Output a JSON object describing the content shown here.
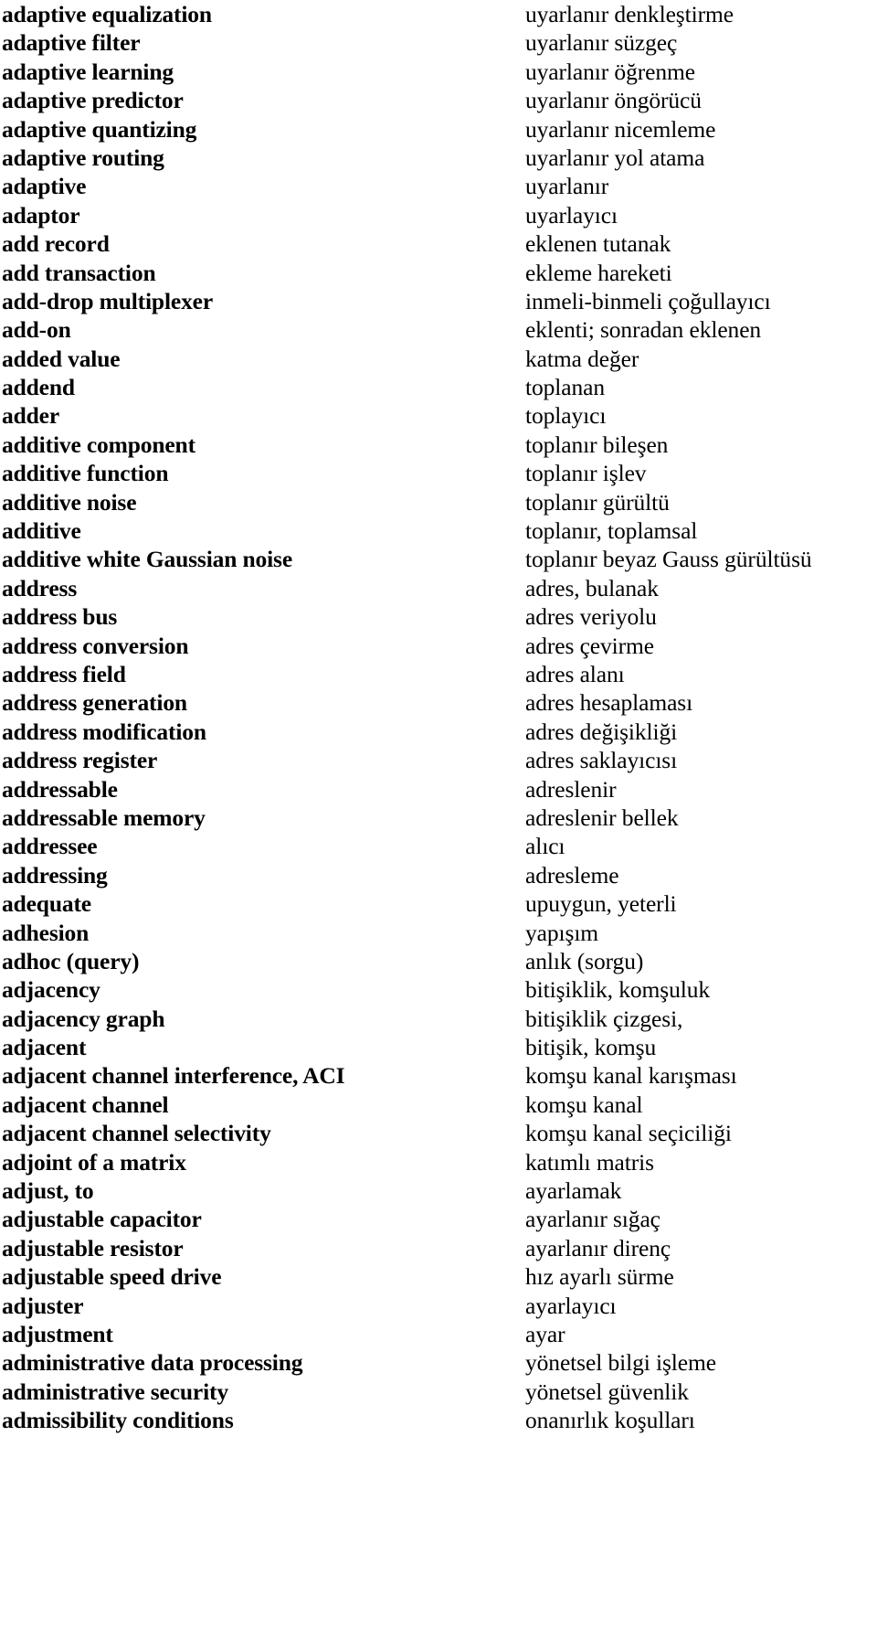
{
  "document": {
    "type": "bilingual-glossary",
    "source_language": "English",
    "target_language": "Turkish",
    "column_headers_visible": false,
    "entry_count": 56
  },
  "entries": [
    {
      "term": "adaptive equalization",
      "gloss": "uyarlanır denkleştirme"
    },
    {
      "term": "adaptive filter",
      "gloss": "uyarlanır süzgeç"
    },
    {
      "term": "adaptive learning",
      "gloss": "uyarlanır öğrenme"
    },
    {
      "term": "adaptive predictor",
      "gloss": "uyarlanır öngörücü"
    },
    {
      "term": "adaptive quantizing",
      "gloss": "uyarlanır nicemleme"
    },
    {
      "term": "adaptive routing",
      "gloss": "uyarlanır yol atama"
    },
    {
      "term": "adaptive",
      "gloss": "uyarlanır"
    },
    {
      "term": "adaptor",
      "gloss": "uyarlayıcı"
    },
    {
      "term": "add record",
      "gloss": "eklenen tutanak"
    },
    {
      "term": "add transaction",
      "gloss": "ekleme hareketi"
    },
    {
      "term": "add-drop multiplexer",
      "gloss": "inmeli-binmeli çoğullayıcı"
    },
    {
      "term": "add-on",
      "gloss": "eklenti; sonradan eklenen"
    },
    {
      "term": "added value",
      "gloss": "katma değer"
    },
    {
      "term": "addend",
      "gloss": "toplanan"
    },
    {
      "term": "adder",
      "gloss": "toplayıcı"
    },
    {
      "term": "additive component",
      "gloss": "toplanır bileşen"
    },
    {
      "term": "additive function",
      "gloss": "toplanır işlev"
    },
    {
      "term": "additive noise",
      "gloss": "toplanır gürültü"
    },
    {
      "term": "additive",
      "gloss": "toplanır, toplamsal"
    },
    {
      "term": "additive white Gaussian noise",
      "gloss": "toplanır beyaz Gauss gürültüsü"
    },
    {
      "term": "address",
      "gloss": "adres, bulanak"
    },
    {
      "term": "address bus",
      "gloss": "adres veriyolu"
    },
    {
      "term": "address conversion",
      "gloss": "adres çevirme"
    },
    {
      "term": "address field",
      "gloss": "adres alanı"
    },
    {
      "term": "address generation",
      "gloss": "adres hesaplaması"
    },
    {
      "term": "address modification",
      "gloss": "adres değişikliği"
    },
    {
      "term": "address register",
      "gloss": "adres saklayıcısı"
    },
    {
      "term": "addressable",
      "gloss": "adreslenir"
    },
    {
      "term": "addressable memory",
      "gloss": "adreslenir bellek"
    },
    {
      "term": "addressee",
      "gloss": "alıcı"
    },
    {
      "term": "addressing",
      "gloss": "adresleme"
    },
    {
      "term": "adequate",
      "gloss": "upuygun, yeterli"
    },
    {
      "term": "adhesion",
      "gloss": "yapışım"
    },
    {
      "term": "adhoc (query)",
      "gloss": "anlık (sorgu)"
    },
    {
      "term": "adjacency",
      "gloss": "bitişiklik, komşuluk"
    },
    {
      "term": "adjacency graph",
      "gloss": "bitişiklik çizgesi,"
    },
    {
      "term": "adjacent",
      "gloss": "bitişik, komşu"
    },
    {
      "term": "adjacent channel interference, ACI",
      "gloss": "komşu kanal karışması"
    },
    {
      "term": "adjacent channel",
      "gloss": "komşu kanal"
    },
    {
      "term": "adjacent channel selectivity",
      "gloss": "komşu kanal seçiciliği"
    },
    {
      "term": "adjoint of a matrix",
      "gloss": "katımlı matris"
    },
    {
      "term": "adjust, to",
      "gloss": "ayarlamak"
    },
    {
      "term": "adjustable capacitor",
      "gloss": "ayarlanır sığaç"
    },
    {
      "term": "adjustable resistor",
      "gloss": "ayarlanır direnç"
    },
    {
      "term": "adjustable speed drive",
      "gloss": "hız ayarlı sürme"
    },
    {
      "term": "adjuster",
      "gloss": "ayarlayıcı"
    },
    {
      "term": "adjustment",
      "gloss": "ayar"
    },
    {
      "term": "administrative data processing",
      "gloss": "yönetsel bilgi işleme"
    },
    {
      "term": "administrative security",
      "gloss": "yönetsel güvenlik"
    },
    {
      "term": "admissibility conditions",
      "gloss": "onanırlık koşulları"
    }
  ]
}
